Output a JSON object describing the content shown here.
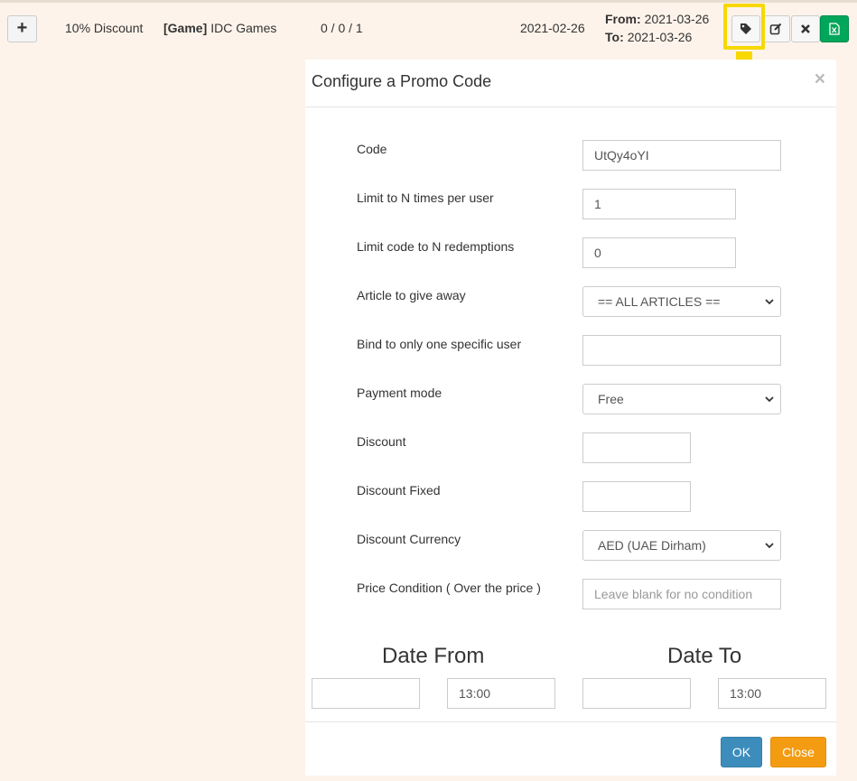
{
  "row": {
    "expand_label": "+",
    "name": "10% Discount",
    "game_tag": "[Game]",
    "game_name": "IDC Games",
    "counts": "0 / 0 / 1",
    "created_date": "2021-02-26",
    "from_label": "From:",
    "from_date": "2021-03-26",
    "to_label": "To:",
    "to_date": "2021-03-26",
    "actions": [
      "tag-icon",
      "edit-icon",
      "delete-icon",
      "excel-icon"
    ],
    "highlight_color": "#f7d800"
  },
  "modal": {
    "title": "Configure a Promo Code",
    "close_label": "×",
    "fields": {
      "code_label": "Code",
      "code_value": "UtQy4oYI",
      "limit_user_label": "Limit to N times per user",
      "limit_user_value": "1",
      "limit_redemptions_label": "Limit code to N redemptions",
      "limit_redemptions_value": "0",
      "article_label": "Article to give away",
      "article_value": "== ALL ARTICLES ==",
      "bind_user_label": "Bind to only one specific user",
      "bind_user_value": "",
      "payment_mode_label": "Payment mode",
      "payment_mode_value": "Free",
      "discount_label": "Discount",
      "discount_value": "",
      "discount_fixed_label": "Discount Fixed",
      "discount_fixed_value": "",
      "discount_currency_label": "Discount Currency",
      "discount_currency_value": "AED (UAE Dirham)",
      "price_condition_label": "Price Condition ( Over the price )",
      "price_condition_placeholder": "Leave blank for no condition"
    },
    "date_from_heading": "Date From",
    "date_from_value": "",
    "date_from_time": "13:00",
    "date_to_heading": "Date To",
    "date_to_value": "",
    "date_to_time": "13:00",
    "ok_label": "OK",
    "close_button_label": "Close"
  }
}
